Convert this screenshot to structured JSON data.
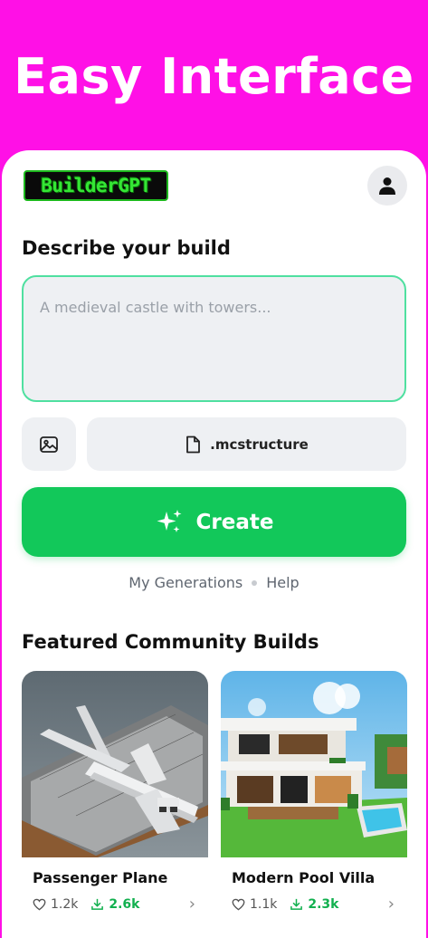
{
  "promo": {
    "title": "Easy Interface"
  },
  "header": {
    "logo_text": "BuilderGPT",
    "avatar_icon": "user-icon"
  },
  "describe": {
    "heading": "Describe your build",
    "placeholder": "A medieval castle with towers...",
    "value": ""
  },
  "tools": {
    "image_icon": "image-icon",
    "format_icon": "file-icon",
    "format_label": ".mcstructure"
  },
  "create": {
    "label": "Create",
    "icon": "sparkles-icon"
  },
  "links": {
    "generations": "My Generations",
    "help": "Help"
  },
  "featured": {
    "heading": "Featured Community Builds",
    "builds": [
      {
        "name": "Passenger Plane",
        "likes": "1.2k",
        "downloads": "2.6k"
      },
      {
        "name": "Modern Pool Villa",
        "likes": "1.1k",
        "downloads": "2.3k"
      }
    ]
  },
  "colors": {
    "promo_bg": "#ff10e6",
    "accent_green": "#12c85a",
    "prompt_border": "#4fe0a0"
  }
}
